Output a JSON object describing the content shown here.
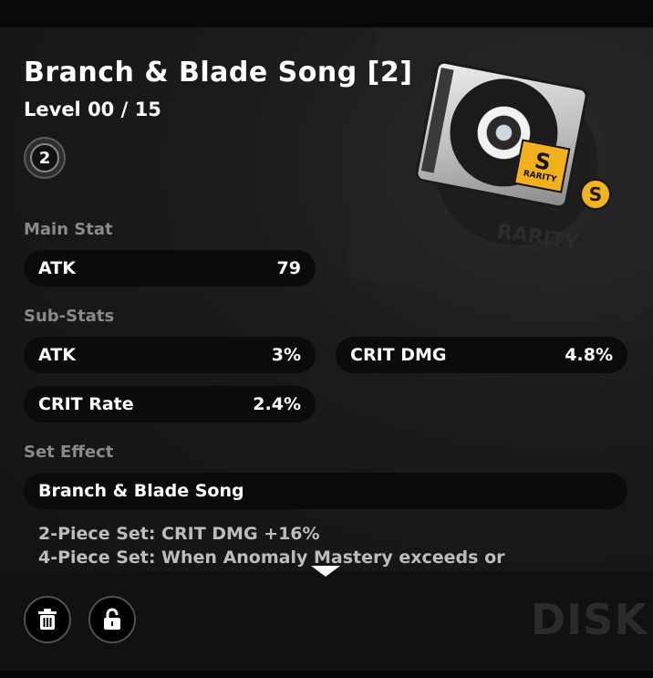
{
  "equipment": {
    "title": "Branch & Blade Song [2]",
    "level_text": "Level 00 / 15",
    "slot_number": "2",
    "rarity_label": "RARITY",
    "rarity_grade": "S"
  },
  "main_stat": {
    "heading": "Main Stat",
    "name": "ATK",
    "value": "79"
  },
  "sub_stats": {
    "heading": "Sub-Stats",
    "items": [
      {
        "name": "ATK",
        "value": "3%"
      },
      {
        "name": "CRIT DMG",
        "value": "4.8%"
      },
      {
        "name": "CRIT Rate",
        "value": "2.4%"
      }
    ]
  },
  "set_effect": {
    "heading": "Set Effect",
    "name": "Branch & Blade Song",
    "line_2pc": "2-Piece Set: CRIT DMG +16%",
    "line_4pc": "4-Piece Set: When Anomaly Mastery exceeds or"
  },
  "footer": {
    "category": "DISK",
    "delete_icon": "trash-icon",
    "lock_icon": "unlock-icon"
  },
  "colors": {
    "rarity_gold": "#f3b31f",
    "pill_bg": "#0b0b0b",
    "heading_gray": "#8a8a8a"
  }
}
